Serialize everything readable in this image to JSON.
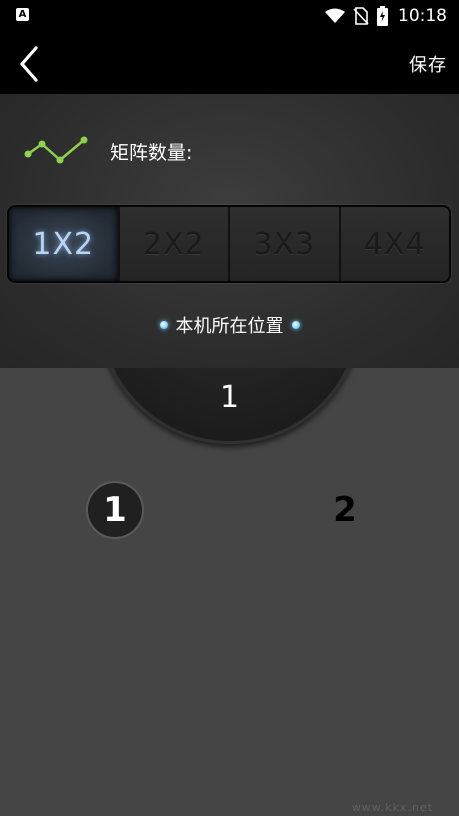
{
  "status_bar": {
    "app_icon_letter": "A",
    "time": "10:18"
  },
  "app_bar": {
    "save_label": "保存"
  },
  "matrix": {
    "label": "矩阵数量:",
    "options": [
      "1X2",
      "2X2",
      "3X3",
      "4X4"
    ],
    "selected": "1X2"
  },
  "location_label": "本机所在位置",
  "current_position": "1",
  "screens": [
    "1",
    "2"
  ],
  "watermark": "www.kkx.net",
  "colors": {
    "accent_dot": "#6cc8ff",
    "selected_text": "#b9d3f2",
    "matrix_icon": "#8fd14f"
  }
}
